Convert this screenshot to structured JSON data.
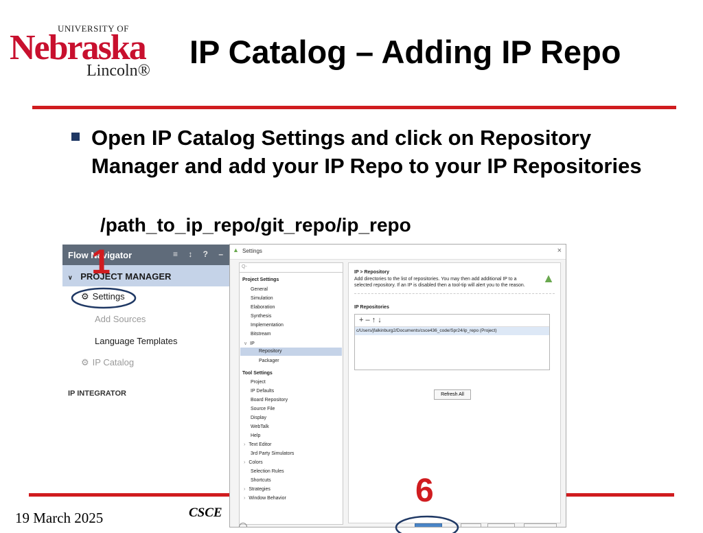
{
  "logo": {
    "university": "UNIVERSITY OF",
    "brand": "Nebraska",
    "city": "Lincoln®"
  },
  "slide": {
    "title": "IP Catalog – Adding IP Repo",
    "bullet": "Open IP Catalog Settings and click on Repository Manager and add your IP Repo to your IP Repositories",
    "path": "/path_to_ip_repo/git_repo/ip_repo",
    "step1": "1",
    "step6": "6",
    "date": "19 March 2025",
    "course": "CSCE"
  },
  "flow_navigator": {
    "title": "Flow Navigator",
    "tools": "≡ ↕ ? –",
    "section": "PROJECT MANAGER",
    "items": [
      "Settings",
      "Add Sources",
      "Language Templates",
      "IP Catalog"
    ],
    "cut_section": "IP INTEGRATOR"
  },
  "settings_dialog": {
    "title": "Settings",
    "close": "×",
    "search_placeholder": "Q-",
    "project_settings_header": "Project Settings",
    "project_items": [
      "General",
      "Simulation",
      "Elaboration",
      "Synthesis",
      "Implementation",
      "Bitstream",
      "IP",
      "Repository",
      "Packager"
    ],
    "tool_settings_header": "Tool Settings",
    "tool_items": [
      "Project",
      "IP Defaults",
      "Board Repository",
      "Source File",
      "Display",
      "WebTalk",
      "Help",
      "Text Editor",
      "3rd Party Simulators",
      "Colors",
      "Selection Rules",
      "Shortcuts",
      "Strategies",
      "Window Behavior"
    ],
    "breadcrumb": "IP > Repository",
    "description": "Add directories to the list of repositories. You may then add additional IP to a selected repository. If an IP is disabled then a tool-tip will alert you to the reason.",
    "repos_label": "IP Repositories",
    "repo_toolbar": "+  –   ↑   ↓",
    "repo_path": "c/Users/jfalkinburg2/Documents/csce436_code/Spr24/ip_repo (Project)",
    "refresh_button": "Refresh All"
  },
  "colors": {
    "unl_red": "#d01c1f",
    "highlight": "#c5d3e8",
    "annotation_circle": "#1f3864"
  }
}
